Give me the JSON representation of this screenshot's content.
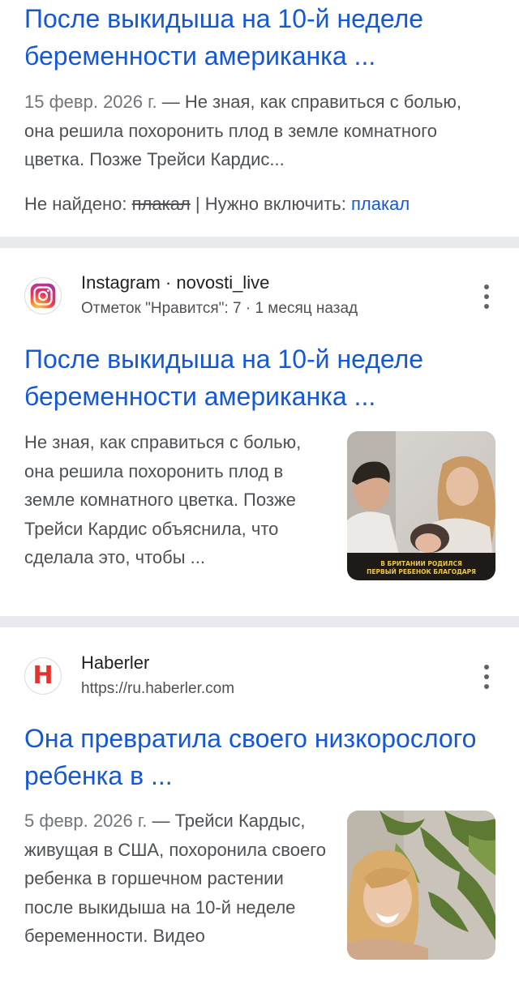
{
  "result1": {
    "title": "После выкидыша на 10-й неделе беременности американка ...",
    "date": "15 февр. 2026 г.",
    "dash": " — ",
    "snippet": "Не зная, как справиться с болью, она решила похоронить плод в земле комнатного цветка. Позже Трейси Кардис...",
    "not_found_label": "Не найдено: ",
    "not_found_word": "плакал",
    "must_include_label": " | Нужно включить: ",
    "must_include_word": "плакал"
  },
  "result2": {
    "source_name": "Instagram · novosti_live",
    "source_sub": "Отметок \"Нравится\": 7 · 1 месяц назад",
    "title": "После выкидыша на 10-й неделе беременности американка ...",
    "snippet": "Не зная, как справиться с болью, она решила похоронить плод в земле комнатного цветка. Позже Трейси Кардис объяснила, что сделала это, чтобы ...",
    "thumb_caption": "В БРИТАНИИ РОДИЛСЯ ПЕРВЫЙ РЕБЕНОК БЛАГОДАРЯ",
    "favicon": "instagram-icon"
  },
  "result3": {
    "source_name": "Haberler",
    "source_url": "https://ru.haberler.com",
    "title": "Она превратила своего низкорослого ребенка в ...",
    "date": "5 февр. 2026 г.",
    "dash": " — ",
    "snippet": "Трейси Кардыс, живущая в США, похоронила своего ребенка в горшечном растении после выкидыша на 10-й неделе беременности. Видео",
    "favicon_letter": "H",
    "favicon": "haberler-icon"
  },
  "colors": {
    "link": "#1558d6",
    "separator": "#e8eaed",
    "haberler_red": "#e5322d"
  }
}
